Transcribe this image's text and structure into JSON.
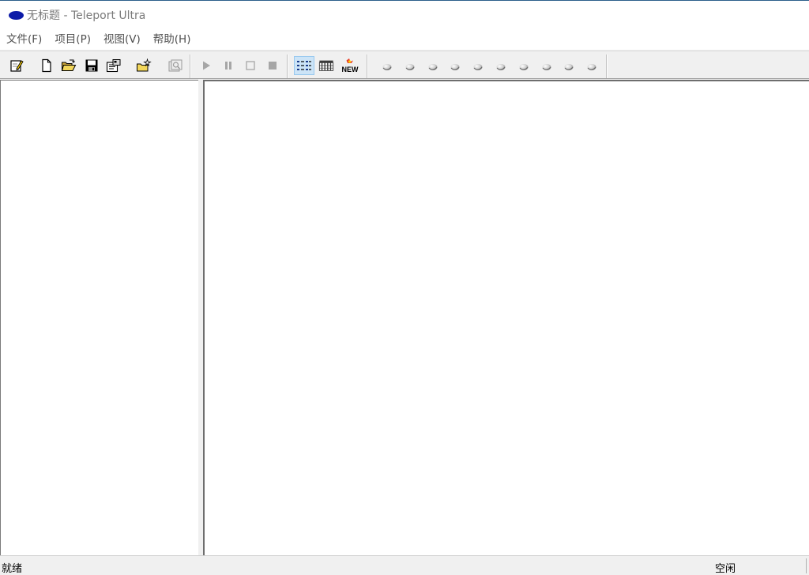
{
  "window": {
    "title": "无标题 - Teleport Ultra",
    "accent_color": "#0c1ba8"
  },
  "menu": {
    "items": [
      {
        "label": "文件(F)"
      },
      {
        "label": "项目(P)"
      },
      {
        "label": "视图(V)"
      },
      {
        "label": "帮助(H)"
      }
    ]
  },
  "toolbar": {
    "buttons": [
      {
        "icon": "new-wizard-icon"
      },
      {
        "icon": "new-document-icon"
      },
      {
        "icon": "open-folder-icon"
      },
      {
        "icon": "save-icon"
      },
      {
        "icon": "properties-icon"
      },
      {
        "icon": "new-folder-icon"
      },
      {
        "icon": "browse-disabled-icon"
      },
      {
        "icon": "play-icon"
      },
      {
        "icon": "pause-icon"
      },
      {
        "icon": "stop-icon"
      },
      {
        "icon": "stop-all-icon"
      },
      {
        "icon": "list-view-icon",
        "pressed": true
      },
      {
        "icon": "grid-view-icon"
      },
      {
        "icon": "new-items-icon",
        "text": "NEW"
      }
    ],
    "thread_indicators": 10
  },
  "status": {
    "left": "就绪",
    "right": "空闲"
  }
}
